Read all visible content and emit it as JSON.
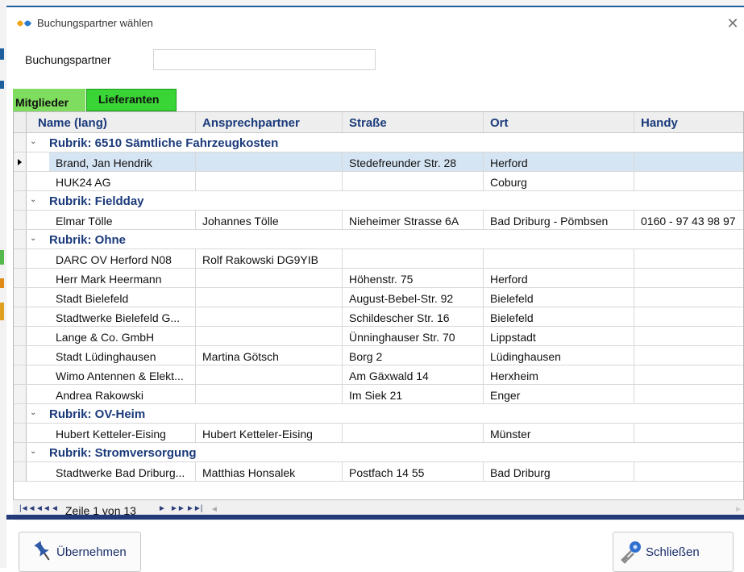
{
  "window": {
    "title": "Buchungspartner wählen",
    "close_glyph": "✕"
  },
  "search": {
    "label": "Buchungspartner",
    "value": ""
  },
  "tabs": [
    {
      "label": "Mitglieder"
    },
    {
      "label": "Lieferanten"
    }
  ],
  "columns": [
    "Name (lang)",
    "Ansprechpartner",
    "Straße",
    "Ort",
    "Handy"
  ],
  "rows": [
    {
      "type": "group",
      "label": "Rubrik: 6510 Sämtliche Fahrzeugkosten"
    },
    {
      "type": "data",
      "selected": true,
      "cells": [
        "Brand, Jan Hendrik",
        "",
        "Stedefreunder Str. 28",
        "Herford",
        ""
      ]
    },
    {
      "type": "data",
      "cells": [
        "HUK24 AG",
        "",
        "",
        "Coburg",
        ""
      ]
    },
    {
      "type": "group",
      "label": "Rubrik: Fieldday"
    },
    {
      "type": "data",
      "cells": [
        "Elmar Tölle",
        "Johannes Tölle",
        "Nieheimer Strasse 6A",
        "Bad Driburg - Pömbsen",
        "0160 - 97 43 98 97"
      ]
    },
    {
      "type": "group",
      "label": "Rubrik: Ohne"
    },
    {
      "type": "data",
      "cells": [
        "DARC OV Herford N08",
        "Rolf Rakowski DG9YIB",
        "",
        "",
        ""
      ]
    },
    {
      "type": "data",
      "cells": [
        "Herr Mark Heermann",
        "",
        "Höhenstr. 75",
        "Herford",
        ""
      ]
    },
    {
      "type": "data",
      "cells": [
        "Stadt Bielefeld",
        "",
        "August-Bebel-Str. 92",
        "Bielefeld",
        ""
      ]
    },
    {
      "type": "data",
      "cells": [
        "Stadtwerke Bielefeld G...",
        "",
        "Schildescher Str. 16",
        "Bielefeld",
        ""
      ]
    },
    {
      "type": "data",
      "cells": [
        "Lange & Co. GmbH",
        "",
        "Ünninghauser Str. 70",
        "Lippstadt",
        ""
      ]
    },
    {
      "type": "data",
      "cells": [
        "Stadt Lüdinghausen",
        "Martina Götsch",
        "Borg 2",
        "Lüdinghausen",
        ""
      ]
    },
    {
      "type": "data",
      "cells": [
        "Wimo Antennen & Elekt...",
        "",
        "Am Gäxwald 14",
        "Herxheim",
        ""
      ]
    },
    {
      "type": "data",
      "cells": [
        "Andrea Rakowski",
        "",
        "Im Siek 21",
        "Enger",
        ""
      ]
    },
    {
      "type": "group",
      "label": "Rubrik: OV-Heim"
    },
    {
      "type": "data",
      "cells": [
        "Hubert Ketteler-Eising",
        "Hubert Ketteler-Eising",
        "",
        "Münster",
        ""
      ]
    },
    {
      "type": "group",
      "label": "Rubrik: Stromversorgung"
    },
    {
      "type": "data",
      "cells": [
        "Stadtwerke Bad Driburg...",
        "Matthias Honsalek",
        "Postfach 14 55",
        "Bad Driburg",
        ""
      ]
    }
  ],
  "pager": {
    "text": "Zeile 1 von 13"
  },
  "buttons": {
    "ok": "Übernehmen",
    "close": "Schließen"
  },
  "colors": {
    "tab_active": "#39d435",
    "tab_inactive": "#7edc5e",
    "selection": "#d6e5f4",
    "header_text": "#1a3a7a"
  }
}
